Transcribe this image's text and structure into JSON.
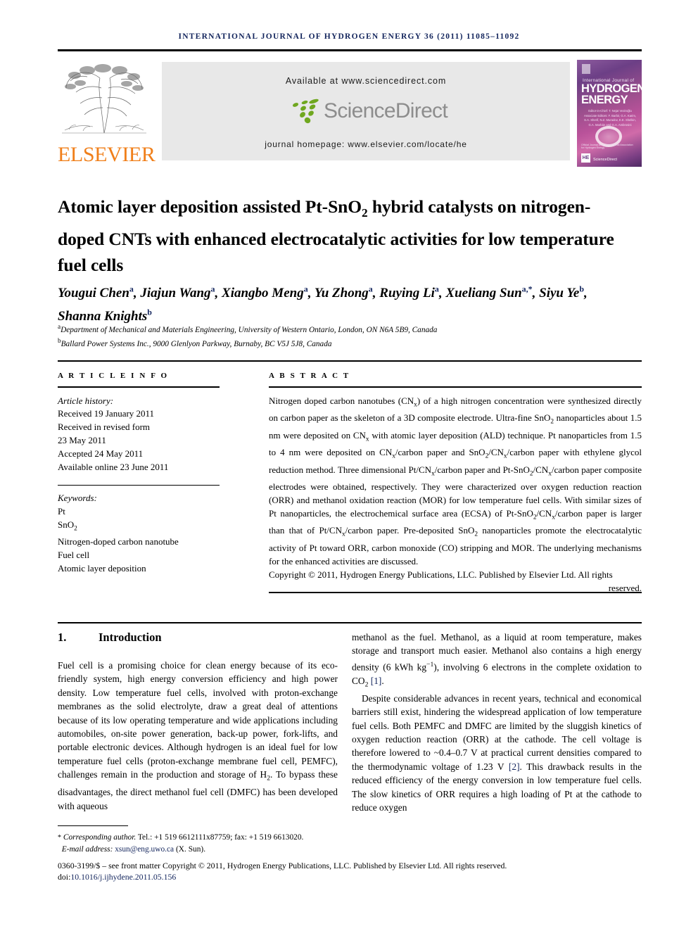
{
  "running_head": "INTERNATIONAL JOURNAL OF HYDROGEN ENERGY 36 (2011) 11085–11092",
  "masthead": {
    "publisher_name": "ELSEVIER",
    "available_at": "Available at www.sciencedirect.com",
    "sciencedirect_word": "ScienceDirect",
    "journal_homepage": "journal homepage: www.elsevier.com/locate/he",
    "cover": {
      "line_small": "International Journal of",
      "line1": "HYDROGEN",
      "line2": "ENERGY",
      "editors": "Editor-in-Chief: T. Nejat Veziroğlu\nAssociate Editors: F. Barbir, G.A. Karim, S.A. Sherif, N.Z. Muradov, E.E. Shelkin, G.A. Marbán and G.A. Ambrosini",
      "footer_text": "Official Journal of the International Association for Hydrogen Energy",
      "sciencedirect_label": "ScienceDirect",
      "he_badge": "HE"
    },
    "accent_orange": "#f07f1a",
    "accent_green": "#6fa71f",
    "box_bg": "#e8e8e8"
  },
  "title": "Atomic layer deposition assisted Pt-SnO2 hybrid catalysts on nitrogen-doped CNTs with enhanced electrocatalytic activities for low temperature fuel cells",
  "authors": [
    {
      "name": "Yougui Chen",
      "sup": "a",
      "sep": ", "
    },
    {
      "name": "Jiajun Wang",
      "sup": "a",
      "sep": ", "
    },
    {
      "name": "Xiangbo Meng",
      "sup": "a",
      "sep": ", "
    },
    {
      "name": "Yu Zhong",
      "sup": "a",
      "sep": ", "
    },
    {
      "name": "Ruying Li",
      "sup": "a",
      "sep": ", "
    },
    {
      "name": "Xueliang Sun",
      "sup": "a,*",
      "sep": ", "
    },
    {
      "name": "Siyu Ye",
      "sup": "b",
      "sep": ", "
    },
    {
      "name": "Shanna Knights",
      "sup": "b",
      "sep": ""
    }
  ],
  "affiliations": [
    {
      "mark": "a",
      "text": "Department of Mechanical and Materials Engineering, University of Western Ontario, London, ON N6A 5B9, Canada"
    },
    {
      "mark": "b",
      "text": "Ballard Power Systems Inc., 9000 Glenlyon Parkway, Burnaby, BC V5J 5J8, Canada"
    }
  ],
  "article_info": {
    "heading": "A R T I C L E   I N F O",
    "history_label": "Article history:",
    "history": [
      "Received 19 January 2011",
      "Received in revised form",
      "23 May 2011",
      "Accepted 24 May 2011",
      "Available online 23 June 2011"
    ],
    "keywords_label": "Keywords:",
    "keywords": [
      "Pt",
      "SnO2",
      "Nitrogen-doped carbon nanotube",
      "Fuel cell",
      "Atomic layer deposition"
    ]
  },
  "abstract": {
    "heading": "A B S T R A C T",
    "body": "Nitrogen doped carbon nanotubes (CNx) of a high nitrogen concentration were synthesized directly on carbon paper as the skeleton of a 3D composite electrode. Ultra-fine SnO2 nanoparticles about 1.5 nm were deposited on CNx with atomic layer deposition (ALD) technique. Pt nanoparticles from 1.5 to 4 nm were deposited on CNx/carbon paper and SnO2/CNx/carbon paper with ethylene glycol reduction method. Three dimensional Pt/CNx/carbon paper and Pt-SnO2/CNx/carbon paper composite electrodes were obtained, respectively. They were characterized over oxygen reduction reaction (ORR) and methanol oxidation reaction (MOR) for low temperature fuel cells. With similar sizes of Pt nanoparticles, the electrochemical surface area (ECSA) of Pt-SnO2/CNx/carbon paper is larger than that of Pt/CNx/carbon paper. Pre-deposited SnO2 nanoparticles promote the electrocatalytic activity of Pt toward ORR, carbon monoxide (CO) stripping and MOR. The underlying mechanisms for the enhanced activities are discussed.",
    "copyright": "Copyright © 2011, Hydrogen Energy Publications, LLC. Published by Elsevier Ltd. All rights",
    "copyright_last": "reserved."
  },
  "section": {
    "number": "1.",
    "title": "Introduction"
  },
  "body": {
    "left_p1": "Fuel cell is a promising choice for clean energy because of its eco-friendly system, high energy conversion efficiency and high power density. Low temperature fuel cells, involved with proton-exchange membranes as the solid electrolyte, draw a great deal of attentions because of its low operating temperature and wide applications including automobiles, on-site power generation, back-up power, fork-lifts, and portable electronic devices. Although hydrogen is an ideal fuel for low temperature fuel cells (proton-exchange membrane fuel cell, PEMFC), challenges remain in the production and storage of H2. To bypass these disadvantages, the direct methanol fuel cell (DMFC) has been developed with aqueous",
    "right_p1_a": "methanol as the fuel. Methanol, as a liquid at room temperature, makes storage and transport much easier. Methanol also contains a high energy density (6 kWh kg",
    "right_p1_sup": "−1",
    "right_p1_b": "), involving 6 electrons in the complete oxidation to CO",
    "right_p1_sub": "2",
    "right_p1_cite": "[1]",
    "right_p2_a": "Despite considerable advances in recent years, technical and economical barriers still exist, hindering the widespread application of low temperature fuel cells. Both PEMFC and DMFC are limited by the sluggish kinetics of oxygen reduction reaction (ORR) at the cathode. The cell voltage is therefore lowered to ~0.4–0.7 V at practical current densities compared to the thermodynamic voltage of 1.23 V ",
    "right_p2_cite": "[2]",
    "right_p2_b": ". This drawback results in the reduced efficiency of the energy conversion in low temperature fuel cells. The slow kinetics of ORR requires a high loading of Pt at the cathode to reduce oxygen"
  },
  "footer": {
    "corresponding_star": "*",
    "corresponding_label": "Corresponding author.",
    "corresponding_tel": " Tel.: +1 519 6612111x87759; fax: +1 519 6613020.",
    "email_label": "E-mail address:",
    "email": "xsun@eng.uwo.ca",
    "email_person": "(X. Sun).",
    "issn_line": "0360-3199/$ – see front matter Copyright © 2011, Hydrogen Energy Publications, LLC. Published by Elsevier Ltd. All rights reserved.",
    "doi_label": "doi:",
    "doi": "10.1016/j.ijhydene.2011.05.156"
  },
  "colors": {
    "navy": "#12245c",
    "orange": "#f07f1a",
    "green": "#6fa71f",
    "gray_box": "#e8e8e8"
  }
}
